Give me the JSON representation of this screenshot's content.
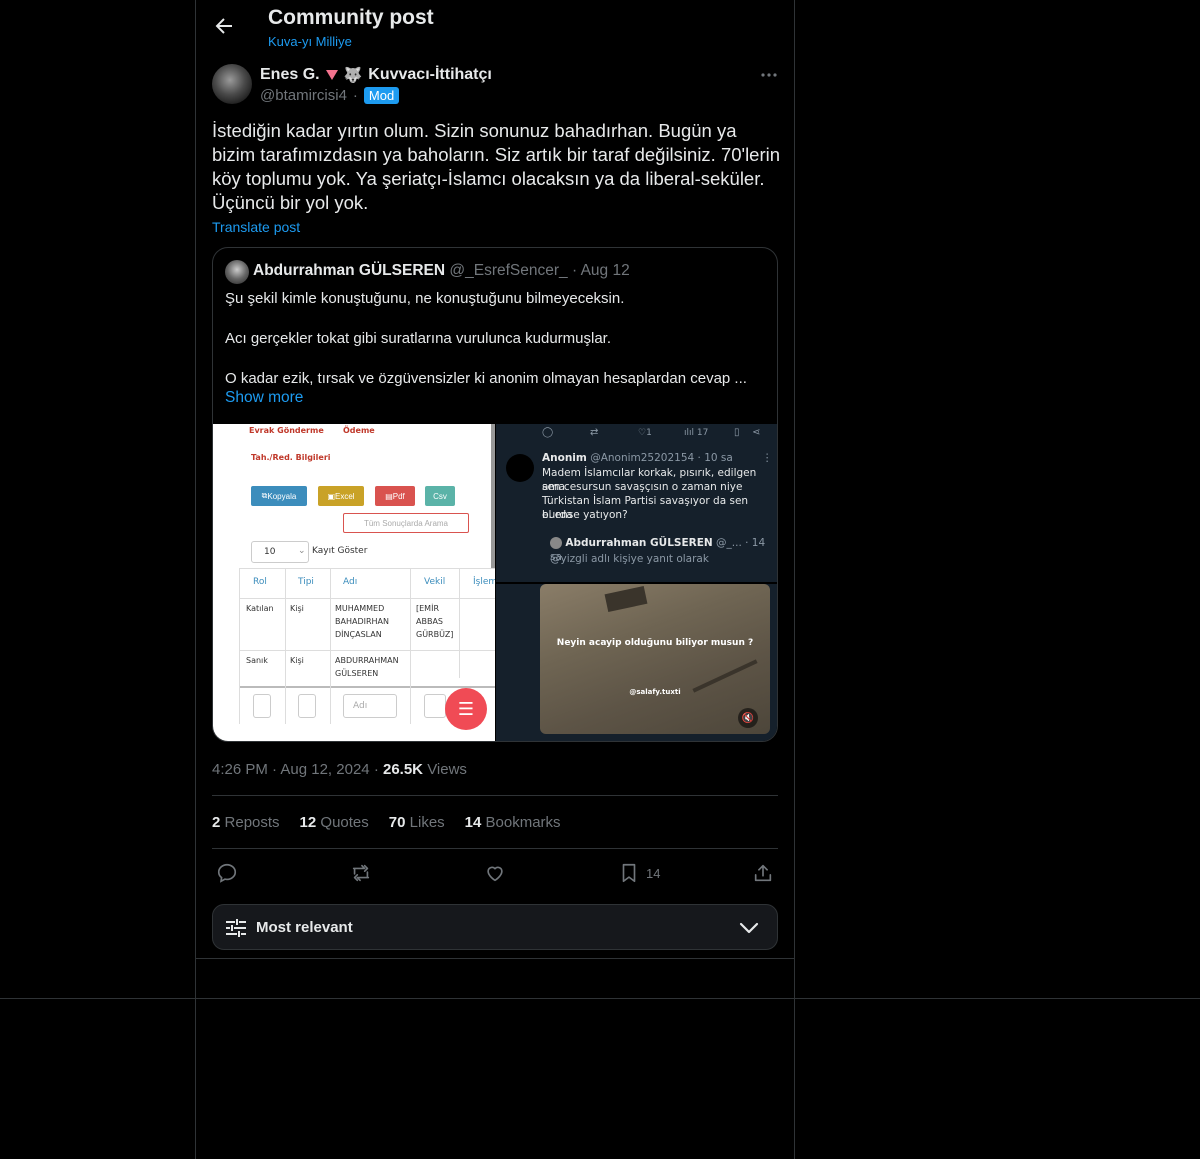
{
  "header": {
    "title": "Community post",
    "community": "Kuva-yı Milliye"
  },
  "author": {
    "name": "Enes G.",
    "flair": "Kuvvacı-İttihatçı",
    "handle": "@btamircisi4",
    "badge": "Mod"
  },
  "post": {
    "text": "İstediğin kadar yırtın olum. Sizin sonunuz bahadırhan. Bugün ya bizim tarafımızdasın ya bahoların. Siz artık bir taraf değilsiniz. 70'lerin köy toplumu yok. Ya şeriatçı-İslamcı olacaksın ya da liberal-seküler. Üçüncü bir yol yok.",
    "translate_label": "Translate post"
  },
  "quote": {
    "name": "Abdurrahman GÜLSEREN",
    "handle": "@_EsrefSencer_",
    "date": "Aug 12",
    "line1": "Şu şekil kimle konuştuğunu, ne konuştuğunu bilmeyeceksin.",
    "line2": "Acı gerçekler tokat gibi suratlarına vurulunca kudurmuşlar.",
    "line3": "O kadar ezik, tırsak ve özgüvensizler ki anonim olmayan hesaplardan cevap ...",
    "show_more": "Show more"
  },
  "media_left": {
    "tab1": "Evrak Gönderme",
    "tab2": "Ödeme",
    "section": "Tah./Red. Bilgileri",
    "btn_copy": "Kopyala",
    "btn_excel": "Excel",
    "btn_pdf": "Pdf",
    "btn_csv": "Csv",
    "search_btn": "Tüm Sonuçlarda Arama",
    "page_size": "10",
    "page_size_label": "Kayıt Göster",
    "col1": "Rol",
    "col2": "Tipi",
    "col3": "Adı",
    "col4": "Vekil",
    "col5": "İşlem",
    "r1c1": "Katılan",
    "r1c2": "Kişi",
    "r1c3a": "MUHAMMED",
    "r1c3b": "BAHADIRHAN",
    "r1c3c": "DİNÇASLAN",
    "r1c4a": "[EMİR",
    "r1c4b": "ABBAS",
    "r1c4c": "GÜRBÜZ]",
    "r2c1": "Sanık",
    "r2c2": "Kişi",
    "r2c3a": "ABDURRAHMAN",
    "r2c3b": "GÜLSEREN",
    "filter_placeholder": "Adı"
  },
  "media_right_top": {
    "likes": "1",
    "views": "17",
    "user": "Anonim",
    "user_handle": "@Anonim25202154 · 10 sa",
    "text1": "Madem İslamcılar korkak, pısırık, edilgen ama",
    "text2": "sen cesursun savaşçısın o zaman niye",
    "text3": "Türkistan İslam Partisi savaşıyor da sen burda",
    "text4": "el ense yatıyon?",
    "reply_user": "Abdurrahman GÜLSEREN",
    "reply_meta": "@_... · 14 sa",
    "reply_to": "@yizgli adlı kişiye yanıt olarak"
  },
  "media_right_bot": {
    "caption": "Neyin acayip olduğunu biliyor musun ?",
    "handle": "@salafy.tuxti"
  },
  "meta": {
    "time": "4:26 PM",
    "date": "Aug 12, 2024",
    "views_count": "26.5K",
    "views_label": "Views"
  },
  "stats": {
    "reposts": "2",
    "reposts_label": "Reposts",
    "quotes": "12",
    "quotes_label": "Quotes",
    "likes": "70",
    "likes_label": "Likes",
    "bookmarks": "14",
    "bookmarks_label": "Bookmarks"
  },
  "actions": {
    "bookmark_count": "14"
  },
  "sort": {
    "label": "Most relevant"
  },
  "colors": {
    "background": "#000000",
    "accent": "#1d9bf0",
    "muted": "#71767b",
    "border": "#2f3336"
  }
}
